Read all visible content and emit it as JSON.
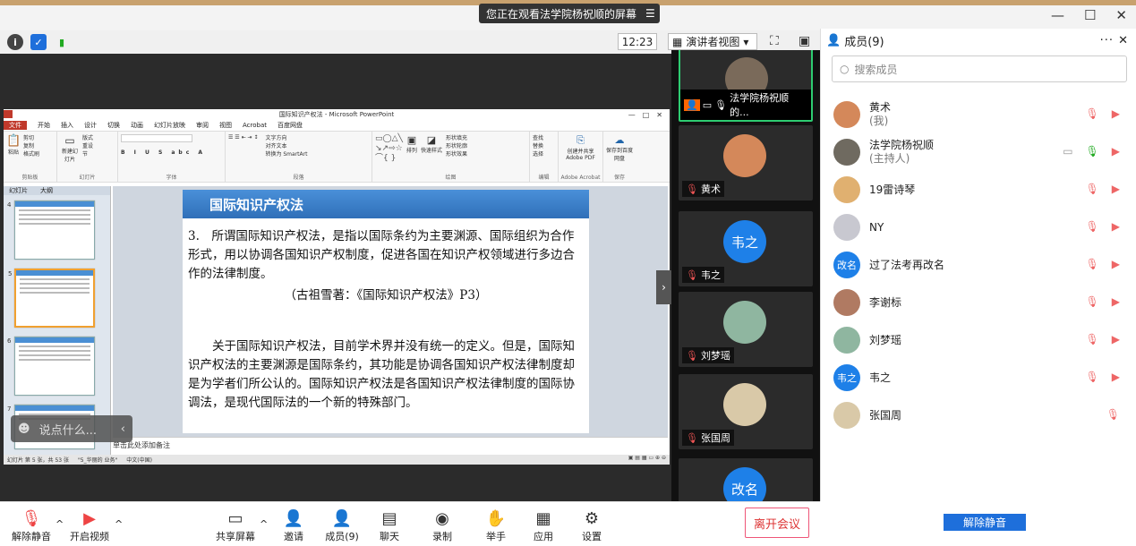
{
  "window": {
    "share_banner": "您正在观看法学院杨祝顺的屏幕",
    "controls": [
      "—",
      "☐",
      "✕"
    ]
  },
  "toolbar": {
    "time": "12:23",
    "view_mode": "演讲者视图"
  },
  "ppt": {
    "window_title": "国际知识产权法 - Microsoft PowerPoint",
    "tabs": [
      "文件",
      "开始",
      "插入",
      "设计",
      "切换",
      "动画",
      "幻灯片放映",
      "审阅",
      "视图",
      "Acrobat",
      "百度网盘"
    ],
    "ribbon_groups": [
      "剪贴板",
      "幻灯片",
      "字体",
      "段落",
      "绘图",
      "编辑",
      "Adobe Acrobat",
      "保存"
    ],
    "ribbon_labels": {
      "paste": "粘贴",
      "cut": "剪切",
      "copy": "复制",
      "format_painter": "格式刷",
      "new_slide": "新建幻灯片",
      "layout": "版式",
      "reset": "重设",
      "section": "节",
      "text_direction": "文字方向",
      "align_text": "对齐文本",
      "smartart": "转换为 SmartArt",
      "arrange": "排列",
      "quick_styles": "快速样式",
      "shape_fill": "形状填充",
      "shape_outline": "形状轮廓",
      "shape_effects": "形状效果",
      "find": "查找",
      "replace": "替换",
      "select": "选择",
      "create_pdf": "创建并共享 Adobe PDF",
      "save_to_baidu": "保存到百度网盘"
    },
    "panel_tabs": [
      "幻灯片",
      "大纲"
    ],
    "thumb_numbers": [
      "4",
      "5",
      "6",
      "7"
    ],
    "slide": {
      "header": "国际知识产权法",
      "para1": "3.　所谓国际知识产权法，是指以国际条约为主要渊源、国际组织为合作形式，用以协调各国知识产权制度，促进各国在知识产权领域进行多边合作的法律制度。",
      "cite": "（古祖雪著：《国际知识产权法》P3）",
      "para2": "　　关于国际知识产权法，目前学术界并没有统一的定义。但是，国际知识产权法的主要渊源是国际条约，其功能是协调各国知识产权法律制度却是为学者们所公认的。国际知识产权法是各国知识产权法律制度的国际协调法，是现代国际法的一个新的特殊部门。"
    },
    "notes_placeholder": "单击此处添加备注",
    "status": [
      "幻灯片 第 5 张，共 53 张",
      "\"5_华丽的 业务\"",
      "中文(中国)"
    ]
  },
  "chat_bubble": "说点什么...",
  "video_tiles": [
    {
      "name": "法学院杨祝顺的...",
      "avatar": "",
      "color": "#7a6a5a",
      "muted": false
    },
    {
      "name": "黄术",
      "avatar": "",
      "color": "#d4885a",
      "muted": true
    },
    {
      "name": "韦之",
      "avatar": "韦之",
      "color": "#1e80e8",
      "muted": true
    },
    {
      "name": "刘梦瑶",
      "avatar": "",
      "color": "#8fb6a0",
      "muted": true
    },
    {
      "name": "张国周",
      "avatar": "",
      "color": "#d9c9a8",
      "muted": true
    },
    {
      "name": "",
      "avatar": "改名",
      "color": "#1e80e8",
      "muted": true
    }
  ],
  "members_panel": {
    "title": "成员(9)",
    "search_placeholder": "搜索成员",
    "members": [
      {
        "name": "黄术",
        "role": "(我)",
        "avatar": "",
        "color": "#d4885a"
      },
      {
        "name": "法学院杨祝顺",
        "role": "(主持人)",
        "avatar": "",
        "color": "#6f6a60"
      },
      {
        "name": "19雷诗琴",
        "role": "",
        "avatar": "",
        "color": "#e0b070"
      },
      {
        "name": "NY",
        "role": "",
        "avatar": "",
        "color": "#c8c8d0"
      },
      {
        "name": "过了法考再改名",
        "role": "",
        "avatar": "改名",
        "color": "#1e80e8"
      },
      {
        "name": "李谢标",
        "role": "",
        "avatar": "",
        "color": "#b07a62"
      },
      {
        "name": "刘梦瑶",
        "role": "",
        "avatar": "",
        "color": "#8fb6a0"
      },
      {
        "name": "韦之",
        "role": "",
        "avatar": "韦之",
        "color": "#1e80e8"
      },
      {
        "name": "张国周",
        "role": "",
        "avatar": "",
        "color": "#d9c9a8"
      }
    ],
    "unmute_all": "解除静音"
  },
  "bottom_bar": {
    "unmute": "解除静音",
    "video": "开启视频",
    "share": "共享屏幕",
    "invite": "邀请",
    "members": "成员(9)",
    "chat": "聊天",
    "record": "录制",
    "raise_hand": "举手",
    "apps": "应用",
    "settings": "设置",
    "leave": "离开会议"
  }
}
